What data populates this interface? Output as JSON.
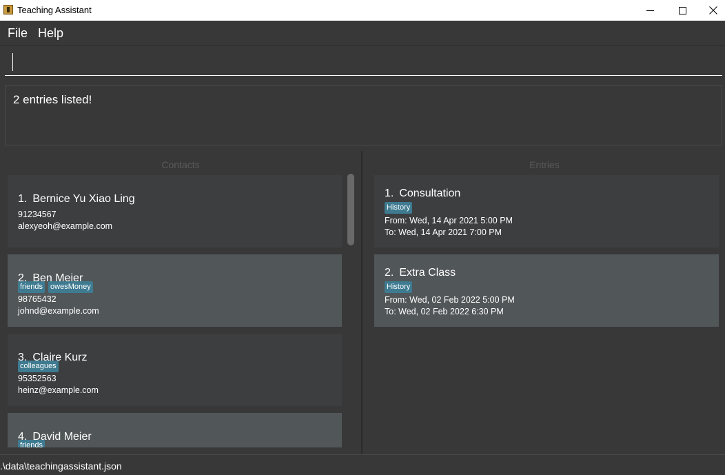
{
  "window": {
    "title": "Teaching Assistant"
  },
  "menu": {
    "file": "File",
    "help": "Help"
  },
  "command": {
    "value": "",
    "placeholder": ""
  },
  "result": {
    "message": "2 entries listed!"
  },
  "contacts": {
    "header": "Contacts",
    "items": [
      {
        "index": "1.",
        "name": "Bernice Yu Xiao Ling",
        "tags": [],
        "phone": "91234567",
        "email": "alexyeoh@example.com"
      },
      {
        "index": "2.",
        "name": "Ben Meier",
        "tags": [
          "friends",
          "owesMoney"
        ],
        "phone": "98765432",
        "email": "johnd@example.com"
      },
      {
        "index": "3.",
        "name": "Claire Kurz",
        "tags": [
          "colleagues"
        ],
        "phone": "95352563",
        "email": "heinz@example.com"
      },
      {
        "index": "4.",
        "name": "David Meier",
        "tags": [
          "friends"
        ],
        "phone": "",
        "email": ""
      }
    ]
  },
  "entries": {
    "header": "Entries",
    "items": [
      {
        "index": "1.",
        "title": "Consultation",
        "tags": [
          "History"
        ],
        "from": "From: Wed, 14 Apr 2021 5:00 PM",
        "to": "To: Wed, 14 Apr 2021 7:00 PM"
      },
      {
        "index": "2.",
        "title": "Extra Class",
        "tags": [
          "History"
        ],
        "from": "From: Wed, 02 Feb 2022 5:00 PM",
        "to": "To: Wed, 02 Feb 2022 6:30 PM"
      }
    ]
  },
  "status": {
    "path": ".\\data\\teachingassistant.json"
  },
  "colors": {
    "background": "#383838",
    "card_odd": "#3c3e3f",
    "card_even": "#515658",
    "tag": "#3e7b91"
  },
  "icons": {
    "app": "app-icon",
    "minimize": "minimize-icon",
    "maximize": "maximize-icon",
    "close": "close-icon"
  }
}
